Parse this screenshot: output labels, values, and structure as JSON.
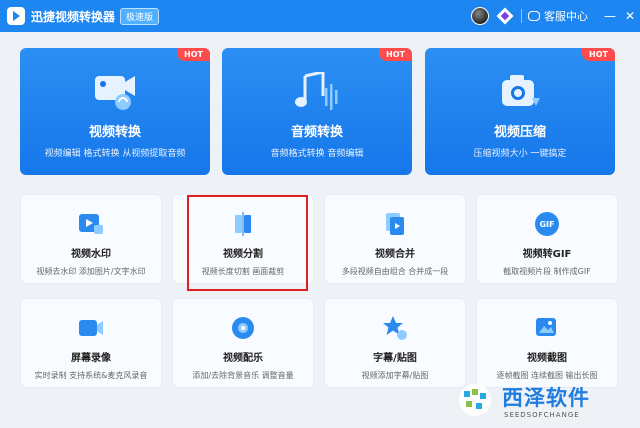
{
  "window": {
    "title": "迅捷视频转换器",
    "badge": "极速版",
    "service_label": "客服中心",
    "minimize": "—",
    "close": "✕"
  },
  "big_cards": [
    {
      "title": "视频转换",
      "subtitle": "视频编辑 格式转换 从视频提取音频",
      "hot": "HOT",
      "icon": "video-convert-icon"
    },
    {
      "title": "音频转换",
      "subtitle": "音频格式转换 音频编辑",
      "hot": "HOT",
      "icon": "audio-convert-icon"
    },
    {
      "title": "视频压缩",
      "subtitle": "压缩视频大小 一键搞定",
      "hot": "HOT",
      "icon": "video-compress-icon"
    }
  ],
  "small_cards": [
    {
      "title": "视频水印",
      "subtitle": "视频去水印 添加图片/文字水印",
      "icon": "watermark-icon"
    },
    {
      "title": "视频分割",
      "subtitle": "视频长度切割 画面裁剪",
      "icon": "split-icon"
    },
    {
      "title": "视频合并",
      "subtitle": "多段视频自由组合 合并成一段",
      "icon": "merge-icon"
    },
    {
      "title": "视频转GIF",
      "subtitle": "截取视频片段 制作成GIF",
      "icon": "gif-icon"
    },
    {
      "title": "屏幕录像",
      "subtitle": "实时录制 支持系统&麦克风录音",
      "icon": "screen-record-icon"
    },
    {
      "title": "视频配乐",
      "subtitle": "添加/去除背景音乐 调整音量",
      "icon": "music-icon"
    },
    {
      "title": "字幕/贴图",
      "subtitle": "视频添加字幕/贴图",
      "icon": "subtitle-icon"
    },
    {
      "title": "视频截图",
      "subtitle": "逐帧截图 连续截图 输出长图",
      "icon": "screenshot-icon"
    }
  ],
  "watermark": {
    "text": "西泽软件",
    "sub": "SEEDSOFCHANGE"
  },
  "colors": {
    "primary": "#1e86f0",
    "hot": "#ff4b4b",
    "highlight": "#e02020"
  }
}
